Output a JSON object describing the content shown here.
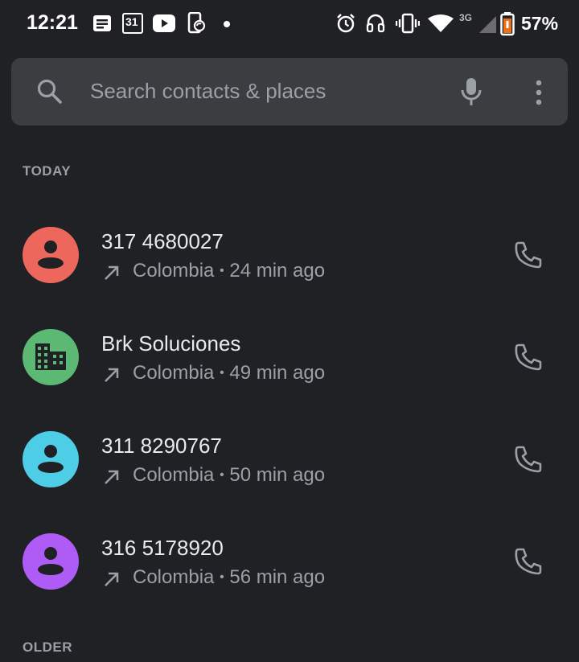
{
  "status_bar": {
    "time": "12:21",
    "calendar_date": "31",
    "network_type": "3G",
    "battery_percent": "57%",
    "icons": [
      "message-icon",
      "calendar-icon",
      "youtube-icon",
      "phone-sync-icon",
      "dot-icon",
      "alarm-icon",
      "headset-icon",
      "vibrate-icon",
      "wifi-icon",
      "signal-icon",
      "battery-icon"
    ]
  },
  "search": {
    "placeholder": "Search contacts & places",
    "icons": [
      "search-icon",
      "mic-icon",
      "more-vert-icon"
    ]
  },
  "sections": {
    "today": "TODAY",
    "older": "OLDER"
  },
  "calls": [
    {
      "name": "317 4680027",
      "location": "Colombia",
      "separator": "•",
      "time": "24 min ago",
      "avatar_color": "#ee675c",
      "avatar_type": "person"
    },
    {
      "name": "Brk Soluciones",
      "location": "Colombia",
      "separator": "•",
      "time": "49 min ago",
      "avatar_color": "#5bb974",
      "avatar_type": "business"
    },
    {
      "name": "311 8290767",
      "location": "Colombia",
      "separator": "•",
      "time": "50 min ago",
      "avatar_color": "#4ecde6",
      "avatar_type": "person"
    },
    {
      "name": "316 5178920",
      "location": "Colombia",
      "separator": "•",
      "time": "56 min ago",
      "avatar_color": "#af5cf7",
      "avatar_type": "person"
    }
  ],
  "colors": {
    "background": "#202124",
    "search_bar": "#3c3d40",
    "primary_text": "#e8eaed",
    "secondary_text": "#9aa0a6"
  }
}
